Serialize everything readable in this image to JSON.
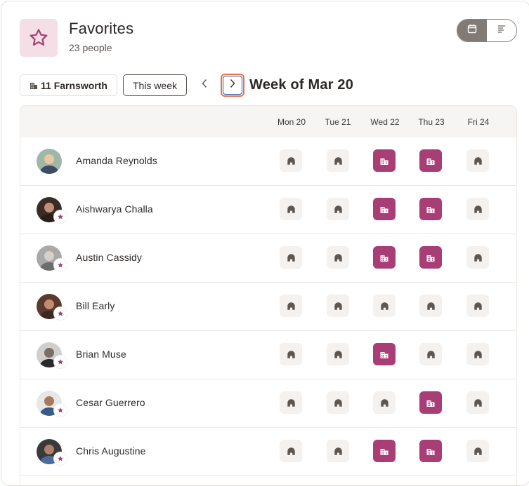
{
  "header": {
    "title": "Favorites",
    "subtitle": "23 people",
    "icon": "star-icon"
  },
  "view_toggle": {
    "options": [
      "calendar-icon",
      "list-icon"
    ],
    "active": "calendar-icon"
  },
  "toolbar": {
    "location_label": "11 Farnsworth",
    "this_week_label": "This week",
    "week_label": "Week of Mar 20"
  },
  "days": [
    "Mon 20",
    "Tue 21",
    "Wed 22",
    "Thu 23",
    "Fri 24"
  ],
  "colors": {
    "office": "#a83e75",
    "remote_bg": "#f4f1ee",
    "accent_focus": "#e8734a"
  },
  "people": [
    {
      "name": "Amanda Reynolds",
      "favorite": false,
      "status": [
        "remote",
        "remote",
        "office",
        "office",
        "remote"
      ]
    },
    {
      "name": "Aishwarya Challa",
      "favorite": true,
      "status": [
        "remote",
        "remote",
        "office",
        "office",
        "remote"
      ]
    },
    {
      "name": "Austin Cassidy",
      "favorite": true,
      "status": [
        "remote",
        "remote",
        "office",
        "office",
        "remote"
      ]
    },
    {
      "name": "Bill Early",
      "favorite": true,
      "status": [
        "remote",
        "remote",
        "remote",
        "remote",
        "remote"
      ]
    },
    {
      "name": "Brian Muse",
      "favorite": true,
      "status": [
        "remote",
        "remote",
        "office",
        "remote",
        "remote"
      ]
    },
    {
      "name": "Cesar Guerrero",
      "favorite": true,
      "status": [
        "remote",
        "remote",
        "remote",
        "office",
        "remote"
      ]
    },
    {
      "name": "Chris Augustine",
      "favorite": true,
      "status": [
        "remote",
        "remote",
        "office",
        "office",
        "remote"
      ]
    }
  ]
}
